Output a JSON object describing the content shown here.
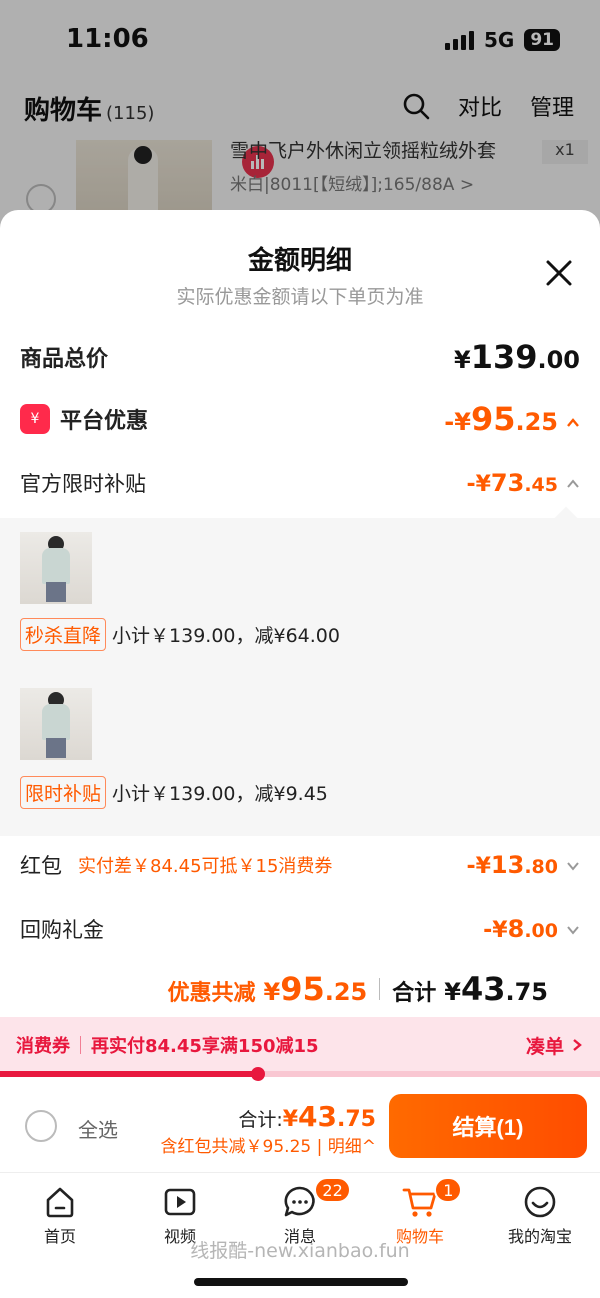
{
  "status_bar": {
    "time": "11:06",
    "network": "5G",
    "battery": "91"
  },
  "cart_header": {
    "title": "购物车",
    "count": "(115)",
    "compare": "对比",
    "manage": "管理"
  },
  "bg_product": {
    "title": "雪中飞户外休闲立领摇粒绒外套",
    "spec": "米白|8011[【短绒】];165/88A >",
    "qty": "x1"
  },
  "sheet": {
    "title": "金额明细",
    "subtitle": "实际优惠金额请以下单页为准",
    "goods_total": {
      "label": "商品总价",
      "currency": "¥",
      "int": "139",
      "dec": ".00"
    },
    "platform": {
      "icon_text": "¥",
      "label": "平台优惠",
      "prefix": "-¥",
      "int": "95",
      "dec": ".25"
    },
    "official": {
      "label": "官方限时补贴",
      "prefix": "-¥",
      "int": "73",
      "dec": ".45"
    },
    "items": [
      {
        "tag": "秒杀直降",
        "text": "小计￥139.00，减¥64.00"
      },
      {
        "tag": "限时补贴",
        "text": "小计￥139.00，减¥9.45"
      }
    ],
    "red_packet": {
      "label": "红包",
      "note": "实付差￥84.45可抵￥15消费券",
      "prefix": "-¥",
      "int": "13",
      "dec": ".80"
    },
    "buyback": {
      "label": "回购礼金",
      "prefix": "-¥",
      "int": "8",
      "dec": ".00"
    },
    "discount_total": {
      "label": "优惠共减",
      "currency": "¥",
      "int": "95",
      "dec": ".25"
    },
    "grand_total": {
      "label": "合计",
      "currency": "¥",
      "int": "43",
      "dec": ".75"
    }
  },
  "coupon": {
    "label": "消费券",
    "text": "再实付84.45享满150减15",
    "action": "凑单",
    "progress": 0.43
  },
  "checkout": {
    "select_all": "全选",
    "sum_label": "合计:",
    "sum_currency": "¥",
    "sum_int": "43",
    "sum_dec": ".75",
    "sum_sub": "含红包共减￥95.25 | 明细^",
    "button": "结算(1)"
  },
  "tabbar": [
    {
      "label": "首页",
      "icon": "home-icon"
    },
    {
      "label": "视频",
      "icon": "video-icon"
    },
    {
      "label": "消息",
      "icon": "message-icon",
      "badge": "22"
    },
    {
      "label": "购物车",
      "icon": "cart-icon",
      "badge": "1",
      "active": true
    },
    {
      "label": "我的淘宝",
      "icon": "profile-icon"
    }
  ],
  "watermark": "线报酷-new.xianbao.fun",
  "colors": {
    "accent": "#ff5a00",
    "coupon_red": "#e8183e",
    "platform_red": "#ff2a4b"
  }
}
